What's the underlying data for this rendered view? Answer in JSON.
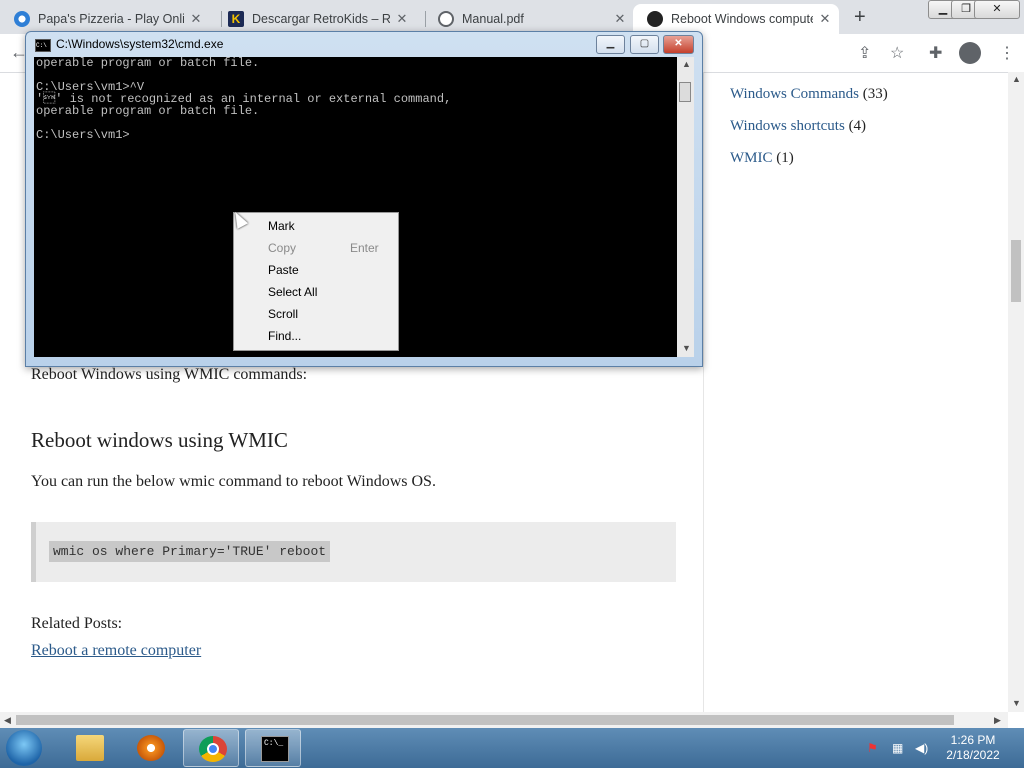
{
  "browser": {
    "tabs": [
      {
        "title": "Papa's Pizzeria - Play Online",
        "active": false
      },
      {
        "title": "Descargar RetroKids – Retro",
        "active": false
      },
      {
        "title": "Manual.pdf",
        "active": false
      },
      {
        "title": "Reboot Windows computer",
        "active": true
      }
    ],
    "new_tab_label": "+"
  },
  "sidebar": {
    "categories": [
      {
        "name": "Windows Commands",
        "count": "(33)"
      },
      {
        "name": "Windows shortcuts",
        "count": "(4)"
      },
      {
        "name": "WMIC",
        "count": "(1)"
      }
    ]
  },
  "article": {
    "intro": "Reboot Windows using WMIC commands:",
    "heading": "Reboot windows using WMIC",
    "description": "You can run the below wmic command to reboot Windows OS.",
    "code": "wmic os where Primary='TRUE' reboot",
    "related_label": "Related Posts:",
    "related_link": "Reboot a remote computer"
  },
  "cmd": {
    "title": "C:\\Windows\\system32\\cmd.exe",
    "console_text": "operable program or batch file.\n\nC:\\Users\\vm1>^V\n'\u0016' is not recognized as an internal or external command,\noperable program or batch file.\n\nC:\\Users\\vm1>",
    "icon_text": "C:\\"
  },
  "context_menu": {
    "items": [
      {
        "label": "Mark",
        "shortcut": "",
        "enabled": true
      },
      {
        "label": "Copy",
        "shortcut": "Enter",
        "enabled": false
      },
      {
        "label": "Paste",
        "shortcut": "",
        "enabled": true
      },
      {
        "label": "Select All",
        "shortcut": "",
        "enabled": true
      },
      {
        "label": "Scroll",
        "shortcut": "",
        "enabled": true
      },
      {
        "label": "Find...",
        "shortcut": "",
        "enabled": true
      }
    ]
  },
  "taskbar": {
    "time": "1:26 PM",
    "date": "2/18/2022",
    "cmd_icon_text": "C:\\_"
  },
  "colors": {
    "link": "#2b5a8a",
    "console_bg": "#000000",
    "console_text": "#c0c0c0"
  }
}
